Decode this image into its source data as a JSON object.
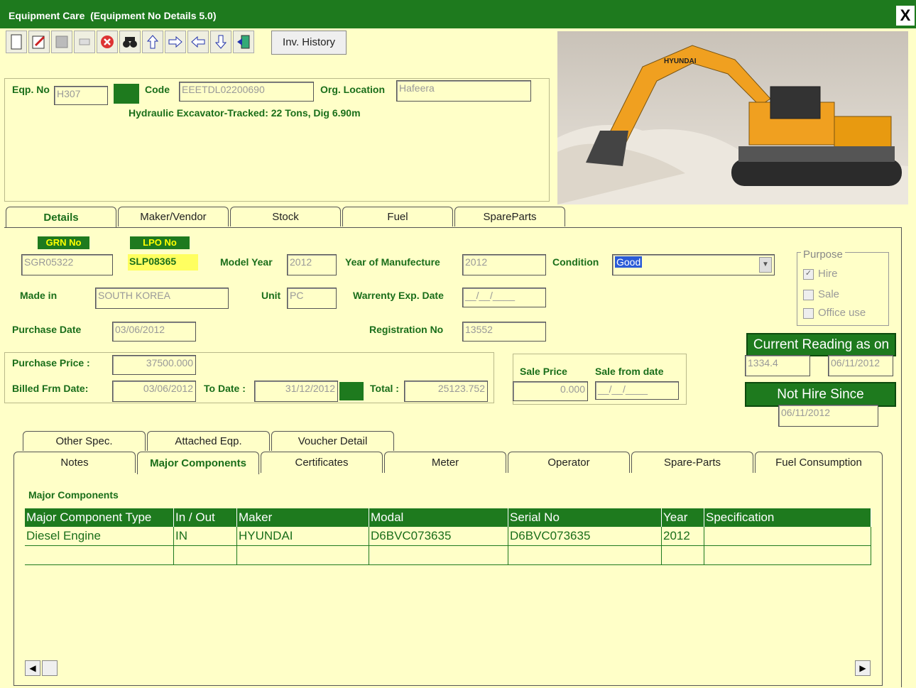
{
  "window": {
    "app": "Equipment Care",
    "title": "(Equipment No Details 5.0)",
    "close_glyph": "X"
  },
  "toolbar": {
    "inv_history": "Inv. History"
  },
  "header": {
    "eqp_no_label": "Eqp. No",
    "eqp_no": "H307",
    "code_label": "Code",
    "code": "EEETDL02200690",
    "org_location_label": "Org. Location",
    "org_location": "Hafeera",
    "description": "Hydraulic Excavator-Tracked: 22 Tons, Dig 6.90m"
  },
  "main_tabs": [
    "Details",
    "Maker/Vendor",
    "Stock",
    "Fuel",
    "SpareParts"
  ],
  "details": {
    "grn_label": "GRN No",
    "grn": "SGR05322",
    "lpo_label": "LPO No",
    "lpo": "SLP08365",
    "model_year_label": "Model Year",
    "model_year": "2012",
    "year_manufacture_label": "Year of Manufecture",
    "year_manufacture": "2012",
    "condition_label": "Condition",
    "condition": "Good",
    "made_in_label": "Made in",
    "made_in": "SOUTH KOREA",
    "unit_label": "Unit",
    "unit": "PC",
    "warranty_label": "Warrenty Exp. Date",
    "warranty": "__/__/____",
    "purchase_date_label": "Purchase Date",
    "purchase_date": "03/06/2012",
    "registration_label": "Registration No",
    "registration": "13552",
    "purchase_price_label": "Purchase Price :",
    "purchase_price": "37500.000",
    "billed_from_label": "Billed Frm Date:",
    "billed_from": "03/06/2012",
    "to_date_label": "To Date :",
    "to_date": "31/12/2012",
    "total_label": "Total :",
    "total": "25123.752",
    "sale_price_label": "Sale Price",
    "sale_price": "0.000",
    "sale_from_label": "Sale from date",
    "sale_from": "__/__/____"
  },
  "purpose": {
    "legend": "Purpose",
    "hire": "Hire",
    "sale": "Sale",
    "office": "Office use"
  },
  "reading": {
    "button": "Current Reading as on",
    "value": "1334.4",
    "date": "06/11/2012"
  },
  "hire": {
    "button": "Not Hire Since",
    "date": "06/11/2012"
  },
  "sub_tabs_row1": [
    "Other Spec.",
    "Attached Eqp.",
    "Voucher Detail"
  ],
  "sub_tabs_row2": [
    "Notes",
    "Major Components",
    "Certificates",
    "Meter",
    "Operator",
    "Spare-Parts",
    "Fuel Consumption"
  ],
  "components": {
    "heading": "Major Components",
    "columns": [
      "Major Component Type",
      "In / Out",
      "Maker",
      "Modal",
      "Serial  No",
      "Year",
      "Specification"
    ],
    "rows": [
      [
        "Diesel Engine",
        "IN",
        "HYUNDAI",
        "D6BVC073635",
        "D6BVC073635",
        "2012",
        ""
      ]
    ]
  },
  "photo": {
    "brand": "HYUNDAI"
  },
  "colors": {
    "accent": "#1e7a1e",
    "background": "#ffffc8"
  }
}
